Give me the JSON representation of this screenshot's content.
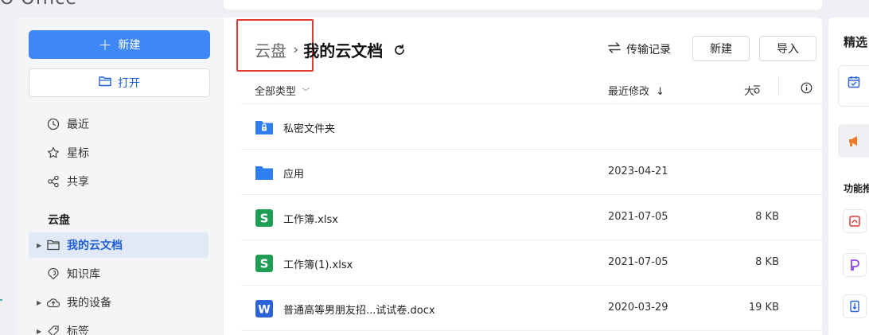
{
  "app": {
    "logo_text": "O Office"
  },
  "sidebar": {
    "new_label": "新建",
    "open_label": "打开",
    "quick": [
      {
        "label": "最近",
        "icon": "clock-icon"
      },
      {
        "label": "星标",
        "icon": "star-icon"
      },
      {
        "label": "共享",
        "icon": "share-icon"
      }
    ],
    "section_title": "云盘",
    "tree": [
      {
        "label": "我的云文档",
        "icon": "folder-icon",
        "active": true
      },
      {
        "label": "知识库",
        "icon": "knowledge-icon"
      },
      {
        "label": "我的设备",
        "icon": "cloud-device-icon"
      },
      {
        "label": "标签",
        "icon": "tag-icon"
      }
    ]
  },
  "main": {
    "breadcrumb_root": "云盘",
    "breadcrumb_current": "我的云文档",
    "transfer_label": "传输记录",
    "new_label": "新建",
    "import_label": "导入",
    "columns": {
      "type": "全部类型",
      "modified": "最近修改",
      "size": "大小"
    },
    "files": [
      {
        "name": "私密文件夹",
        "date": "",
        "size": "",
        "icon": "private-folder-icon"
      },
      {
        "name": "应用",
        "date": "2023-04-21",
        "size": "",
        "icon": "folder-icon"
      },
      {
        "name": "工作簿.xlsx",
        "date": "2021-07-05",
        "size": "8 KB",
        "icon": "spreadsheet-icon"
      },
      {
        "name": "工作簿(1).xlsx",
        "date": "2021-07-05",
        "size": "8 KB",
        "icon": "spreadsheet-icon"
      },
      {
        "name": "普通高等男朋友招...试试卷.docx",
        "date": "2020-03-29",
        "size": "19 KB",
        "icon": "word-doc-icon"
      }
    ]
  },
  "right_panel": {
    "title": "精选",
    "subtitle": "功能推"
  },
  "colors": {
    "accent": "#3e87f5",
    "highlight_box": "#e53935",
    "sheet_green": "#1f9d55",
    "word_blue": "#2b63d9"
  }
}
